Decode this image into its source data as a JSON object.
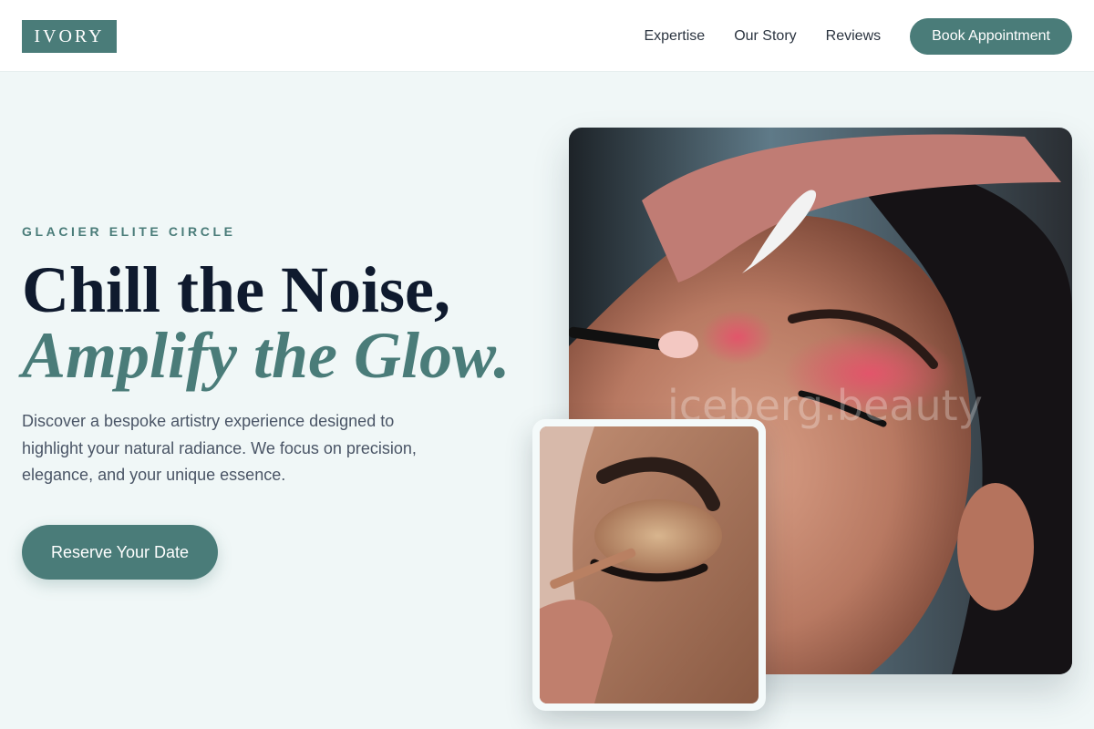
{
  "nav": {
    "logo": "IVORY",
    "links": [
      "Expertise",
      "Our Story",
      "Reviews"
    ],
    "cta": "Book Appointment"
  },
  "hero": {
    "eyebrow": "GLACIER ELITE CIRCLE",
    "headline_line1": "Chill the Noise,",
    "headline_line2": "Amplify the Glow.",
    "description": "Discover a bespoke artistry experience designed to highlight your natural radiance. We focus on precision, elegance, and your unique essence.",
    "cta": "Reserve Your Date"
  },
  "images": {
    "main_watermark": "iceberg.beauty"
  },
  "colors": {
    "accent": "#4a7c79",
    "heading": "#0f1a2e",
    "body_text": "#4a5566",
    "background": "#f0f7f7"
  }
}
